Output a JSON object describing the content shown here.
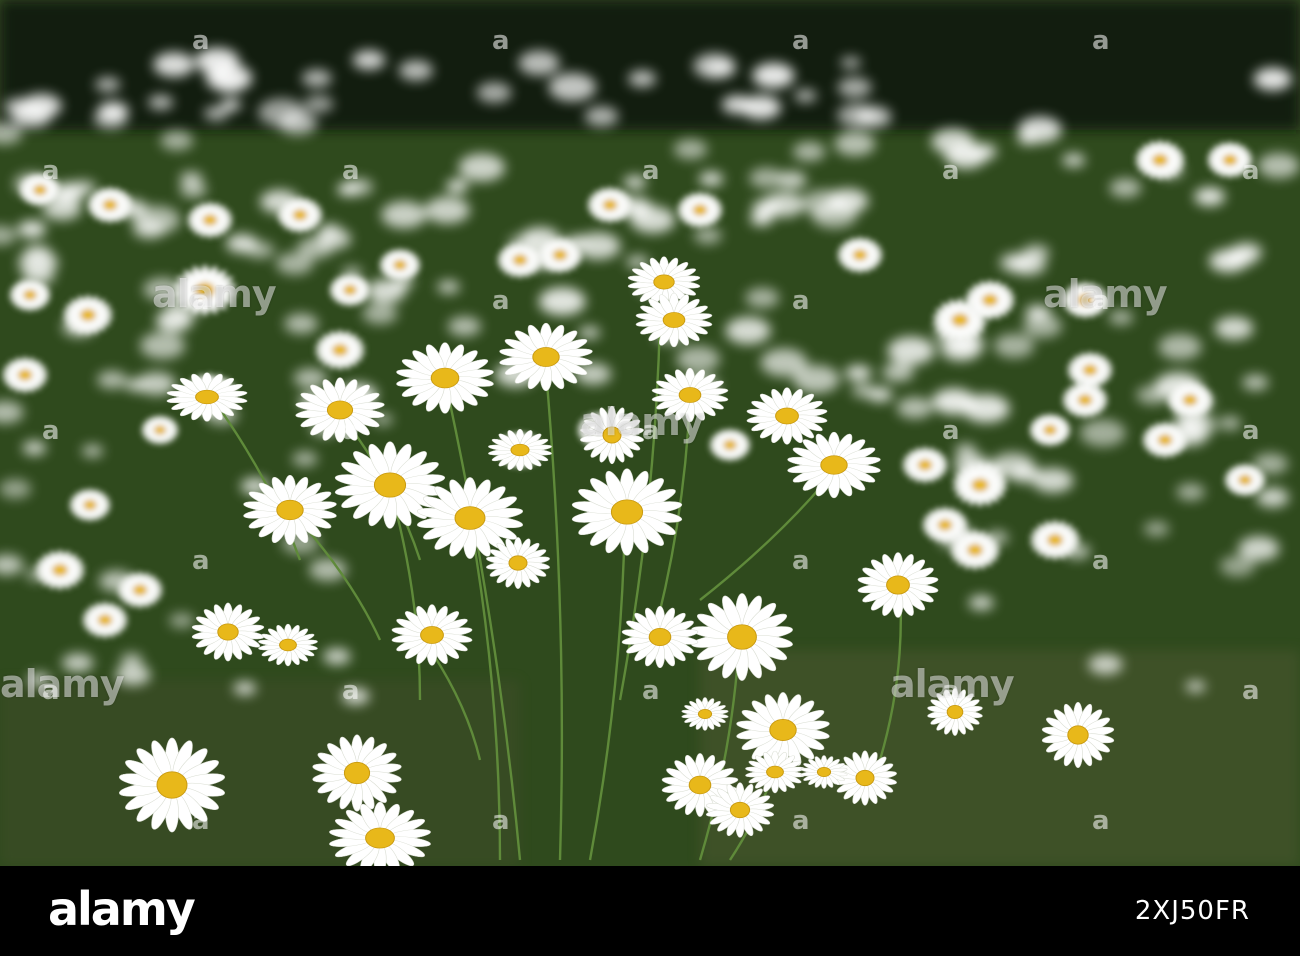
{
  "photo": {
    "subject": "daisy-meadow",
    "colors": {
      "petal": "#ffffff",
      "center": "#e8b81a",
      "foliage": "#35521f",
      "shadow": "#0b140b"
    }
  },
  "watermark": {
    "text": "alamy",
    "mark": "a"
  },
  "footer": {
    "logo": "alamy",
    "image_id": "2XJ50FR"
  }
}
